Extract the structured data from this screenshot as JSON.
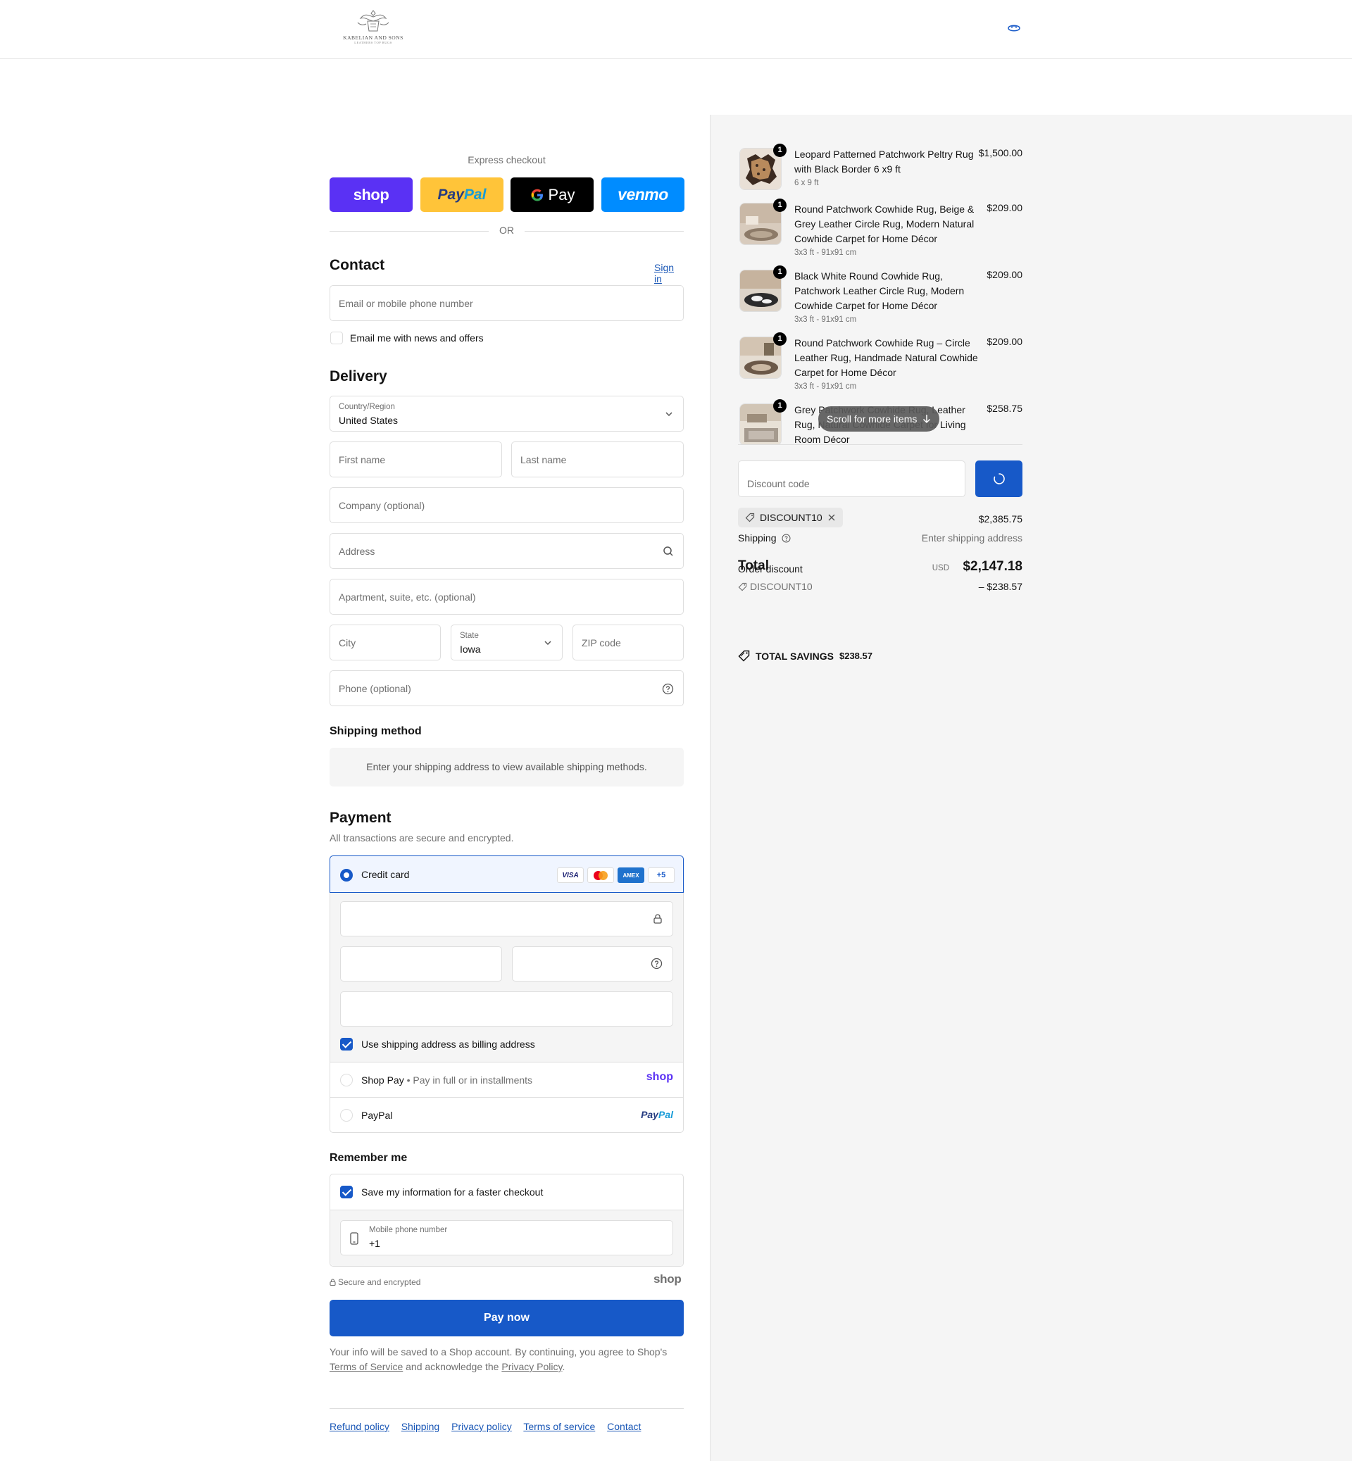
{
  "store": {
    "name": "KABELIAN AND SONS",
    "tagline": "LEATHERS TOP RUGS"
  },
  "express": {
    "title": "Express checkout",
    "buttons": [
      "shop",
      "PayPal",
      "Pay",
      "venmo"
    ],
    "or": "OR"
  },
  "contact": {
    "heading": "Contact",
    "sign_in": "Sign in",
    "email_placeholder": "Email or mobile phone number",
    "news_label": "Email me with news and offers"
  },
  "delivery": {
    "heading": "Delivery",
    "country_label": "Country/Region",
    "country_value": "United States",
    "first_name": "First name",
    "last_name": "Last name",
    "company": "Company (optional)",
    "address": "Address",
    "apartment": "Apartment, suite, etc. (optional)",
    "city": "City",
    "state_label": "State",
    "state_value": "Iowa",
    "zip": "ZIP code",
    "phone": "Phone (optional)"
  },
  "shipping_method": {
    "heading": "Shipping method",
    "message": "Enter your shipping address to view available shipping methods."
  },
  "payment": {
    "heading": "Payment",
    "subtitle": "All transactions are secure and encrypted.",
    "credit_card": "Credit card",
    "card_brands": [
      "VISA",
      "AMEX",
      "+5"
    ],
    "billing_label": "Use shipping address as billing address",
    "shop_pay": "Shop Pay",
    "shop_pay_sub": "Pay in full or in installments",
    "shop_logo": "shop",
    "paypal": "PayPal"
  },
  "remember": {
    "heading": "Remember me",
    "save_label": "Save my information for a faster checkout",
    "mobile_label": "Mobile phone number",
    "mobile_value": "+1"
  },
  "secure_text": "Secure and encrypted",
  "secure_shop": "shop",
  "pay_now": "Pay now",
  "legal": {
    "text1": "Your info will be saved to a Shop account. By continuing, you agree to Shop's",
    "tos": "Terms of Service",
    "text2": "and acknowledge the",
    "privacy": "Privacy Policy",
    "text3": "."
  },
  "footer": [
    "Refund policy",
    "Shipping",
    "Privacy policy",
    "Terms of service",
    "Contact"
  ],
  "summary": {
    "items": [
      {
        "qty": "1",
        "title": "Leopard Patterned Patchwork Peltry Rug with Black Border 6 x9 ft",
        "variant": "6 x 9 ft",
        "price": "$1,500.00"
      },
      {
        "qty": "1",
        "title": "Round Patchwork Cowhide Rug, Beige & Grey Leather Circle Rug, Modern Natural Cowhide Carpet for Home Décor",
        "variant": "3x3 ft - 91x91 cm",
        "price": "$209.00"
      },
      {
        "qty": "1",
        "title": "Black White Round Cowhide Rug, Patchwork Leather Circle Rug, Modern Cowhide Carpet for Home Décor",
        "variant": "3x3 ft - 91x91 cm",
        "price": "$209.00"
      },
      {
        "qty": "1",
        "title": "Round Patchwork Cowhide Rug – Circle Leather Rug, Handmade Natural Cowhide Carpet for Home Décor",
        "variant": "3x3 ft - 91x91 cm",
        "price": "$209.00"
      },
      {
        "qty": "1",
        "title": "Grey Patchwork Cowhide Rug, Leather Rug, Natural Cowhide Carpet for Living Room Décor",
        "variant": "",
        "price": "$258.75"
      }
    ],
    "scroll_hint": "Scroll for more items",
    "discount_placeholder": "Discount code",
    "discount_tag": "DISCOUNT10",
    "subtotal_value": "$2,385.75",
    "shipping_label": "Shipping",
    "shipping_value": "Enter shipping address",
    "order_discount_label": "Order discount",
    "order_discount_code": "DISCOUNT10",
    "order_discount_value": "– $238.57",
    "total_label": "Total",
    "total_currency": "USD",
    "total_value": "$2,147.18",
    "savings_label": "TOTAL SAVINGS",
    "savings_value": "$238.57"
  },
  "colors": {
    "accent": "#1759c8",
    "shop": "#5a31f4",
    "paypal": "#ffc439",
    "venmo": "#008cff",
    "panel": "#f5f5f5"
  }
}
